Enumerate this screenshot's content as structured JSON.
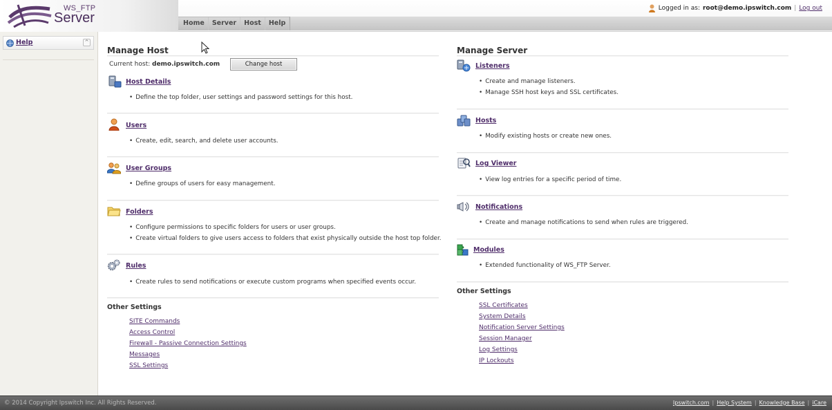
{
  "header": {
    "logo_small": "WS_FTP",
    "logo_big": "Server",
    "nav": [
      "Home",
      "Server",
      "Host",
      "Help"
    ],
    "login_prefix": "Logged in as:",
    "login_user": "root@demo.ipswitch.com",
    "logout_label": "Log out",
    "separator": "|"
  },
  "sidebar": {
    "help_label": "Help",
    "collapse_glyph": "^"
  },
  "manage_host": {
    "title": "Manage Host",
    "current_host_label": "Current host:",
    "current_host_value": "demo.ipswitch.com",
    "change_host_button": "Change host",
    "items": [
      {
        "icon": "host-details-icon",
        "label": "Host Details",
        "bullets": [
          "Define the top folder, user settings and password settings for this host."
        ]
      },
      {
        "icon": "user-icon",
        "label": "Users",
        "bullets": [
          "Create, edit, search, and delete user accounts."
        ]
      },
      {
        "icon": "user-groups-icon",
        "label": "User Groups",
        "bullets": [
          "Define groups of users for easy management."
        ]
      },
      {
        "icon": "folder-icon",
        "label": "Folders",
        "bullets": [
          "Configure permissions to specific folders for users or user groups.",
          "Create virtual folders to give users access to folders that exist physically outside the host top folder."
        ]
      },
      {
        "icon": "rules-gear-icon",
        "label": "Rules",
        "bullets": [
          "Create rules to send notifications or execute custom programs when specified events occur."
        ]
      }
    ],
    "other_title": "Other Settings",
    "other_links": [
      "SITE Commands",
      "Access Control",
      "Firewall - Passive Connection Settings",
      "Messages",
      "SSL Settings"
    ]
  },
  "manage_server": {
    "title": "Manage Server",
    "items": [
      {
        "icon": "listeners-icon",
        "label": "Listeners",
        "bullets": [
          "Create and manage listeners.",
          "Manage SSH host keys and SSL certificates."
        ]
      },
      {
        "icon": "hosts-icon",
        "label": "Hosts",
        "bullets": [
          "Modify existing hosts or create new ones."
        ]
      },
      {
        "icon": "log-viewer-icon",
        "label": "Log Viewer",
        "bullets": [
          "View log entries for a specific period of time."
        ]
      },
      {
        "icon": "notifications-icon",
        "label": "Notifications",
        "bullets": [
          "Create and manage notifications to send when rules are triggered."
        ]
      },
      {
        "icon": "modules-icon",
        "label": "Modules",
        "bullets": [
          "Extended functionality of WS_FTP Server."
        ]
      }
    ],
    "other_title": "Other Settings",
    "other_links": [
      "SSL Certificates",
      "System Details",
      "Notification Server Settings",
      "Session Manager",
      "Log Settings",
      "IP Lockouts"
    ]
  },
  "footer": {
    "copyright": "© 2014 Copyright Ipswitch Inc. All Rights Reserved.",
    "links": [
      "Ipswitch.com",
      "Help System",
      "Knowledge Base",
      "iCare"
    ],
    "separator": "|"
  },
  "colors": {
    "link": "#4f2d6a",
    "brand": "#4a2e5c",
    "footer_bg": "#555555"
  }
}
